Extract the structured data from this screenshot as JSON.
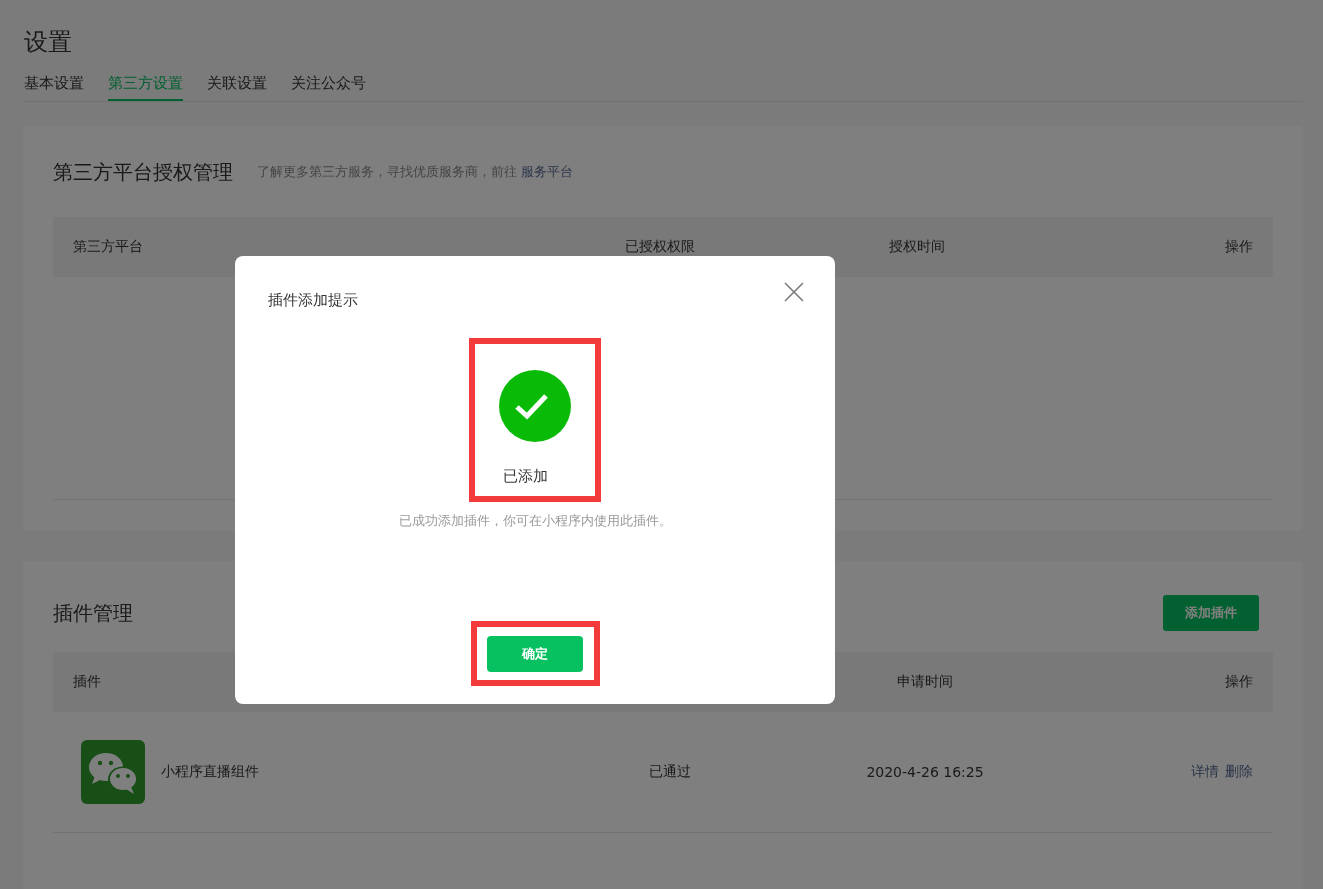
{
  "page_title": "设置",
  "tabs": [
    {
      "label": "基本设置",
      "selected": false
    },
    {
      "label": "第三方设置",
      "selected": true
    },
    {
      "label": "关联设置",
      "selected": false
    },
    {
      "label": "关注公众号",
      "selected": false
    }
  ],
  "auth_section": {
    "title": "第三方平台授权管理",
    "hint": "了解更多第三方服务，寻找优质服务商，前往",
    "link": "服务平台",
    "columns": [
      "第三方平台",
      "已授权权限",
      "授权时间",
      "操作"
    ]
  },
  "plugin_section": {
    "title": "插件管理",
    "add_button": "添加插件",
    "columns": [
      "插件",
      "申请时间",
      "操作"
    ],
    "rows": [
      {
        "name": "小程序直播组件",
        "status": "已通过",
        "time": "2020-4-26 16:25",
        "actions": [
          "详情",
          "删除"
        ]
      }
    ]
  },
  "dialog": {
    "title": "插件添加提示",
    "result": "已添加",
    "message": "已成功添加插件，你可在小程序内使用此插件。",
    "confirm": "确定",
    "result_highlighted": true,
    "confirm_highlighted": true
  }
}
